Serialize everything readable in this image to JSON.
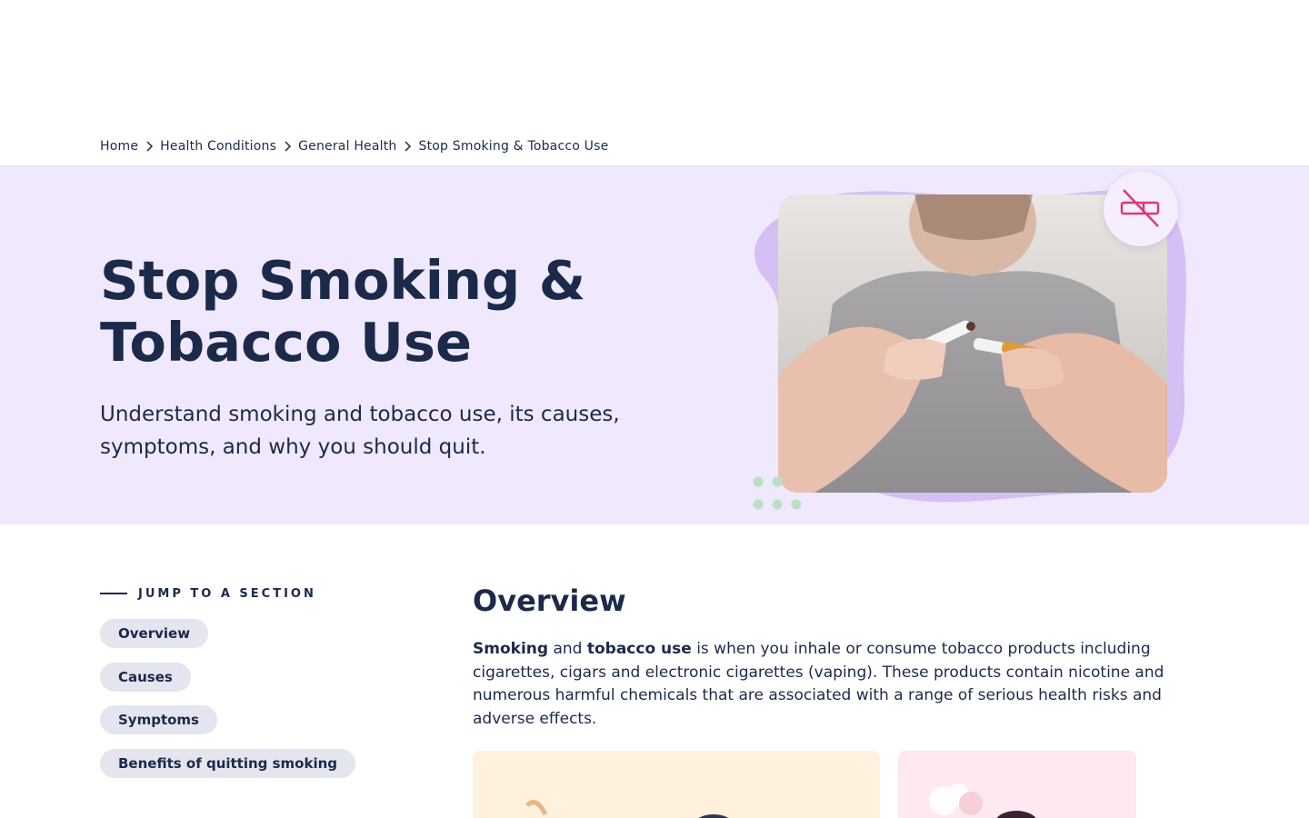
{
  "breadcrumb": {
    "items": [
      "Home",
      "Health Conditions",
      "General Health",
      "Stop Smoking & Tobacco Use"
    ]
  },
  "hero": {
    "title": "Stop Smoking & Tobacco Use",
    "subtitle": "Understand smoking and tobacco use, its causes, symptoms, and why you should quit.",
    "badge_icon": "no-smoking-icon"
  },
  "toc": {
    "heading": "JUMP TO A SECTION",
    "items": [
      "Overview",
      "Causes",
      "Symptoms",
      "Benefits of quitting smoking"
    ]
  },
  "overview": {
    "title": "Overview",
    "term1": "Smoking",
    "connector": " and ",
    "term2": "tobacco use",
    "body": " is when you inhale or consume tobacco products including cigarettes, cigars and electronic cigarettes (vaping). These products contain nicotine and numerous harmful chemicals that are associated with a range of serious health risks and adverse effects."
  },
  "colors": {
    "hero_bg": "#f0e8fc",
    "text": "#1b2a4a",
    "accent_pink": "#d93a7a",
    "blob": "#d9c3f5",
    "dots": "#b9dfc7",
    "pill_bg": "#e4e5ee"
  }
}
